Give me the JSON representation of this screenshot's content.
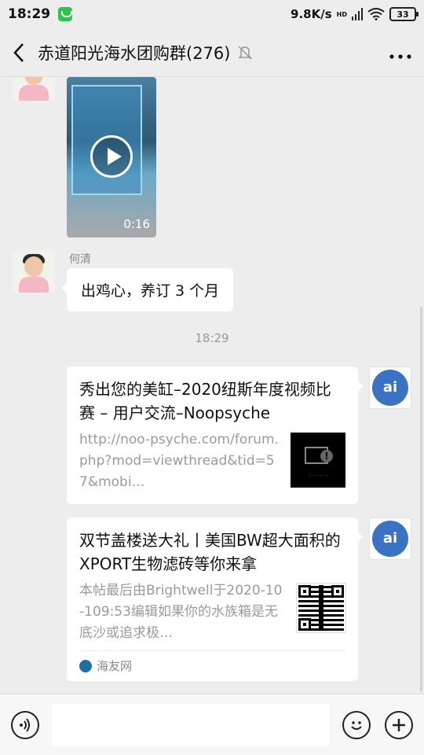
{
  "status_bar": {
    "time": "18:29",
    "network_speed": "9.8K/s",
    "network_type": "HD",
    "battery": "33"
  },
  "header": {
    "title": "赤道阳光海水团购群(276)"
  },
  "messages": {
    "video": {
      "duration": "0:16"
    },
    "text_message": {
      "sender": "何清",
      "text": "出鸡心，养订 3 个月"
    },
    "time_divider": "18:29",
    "card1": {
      "title": "秀出您的美缸–2020纽斯年度视频比赛 – 用户交流–Noopsyche",
      "description": "http://noo-psyche.com/forum.php?mod=viewthread&tid=57&mobi…"
    },
    "card2": {
      "title": "双节盖楼送大礼丨美国BW超大面积的XPORT生物滤砖等你来拿",
      "description": "本帖最后由Brightwell于2020-10-109:53编辑如果你的水族箱是无底沙或追求极…",
      "source": "海友网"
    }
  },
  "icons": {
    "back": "chevron-left-icon",
    "mute": "bell-off-icon",
    "more": "ellipsis-icon",
    "voice": "voice-icon",
    "emoji": "smile-icon",
    "plus": "plus-icon"
  }
}
